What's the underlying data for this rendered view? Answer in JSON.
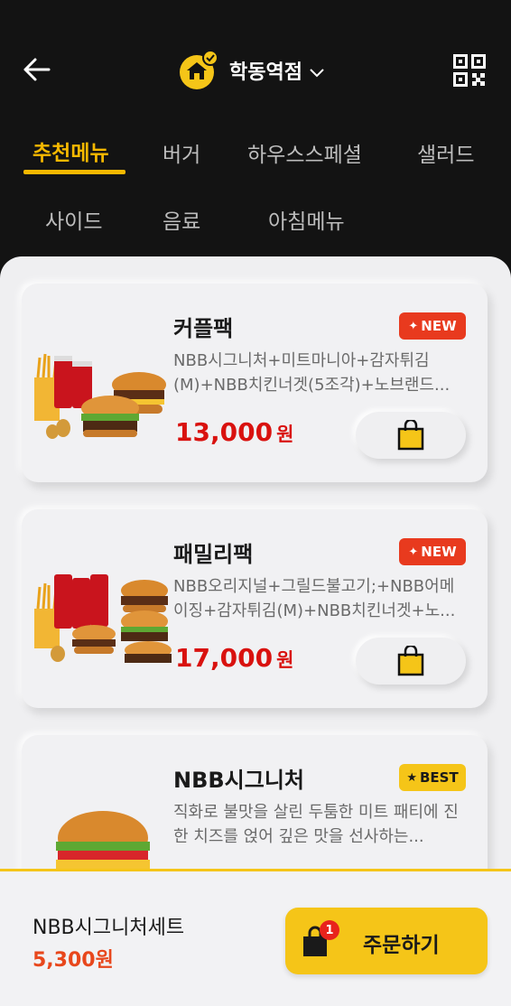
{
  "header": {
    "store_name": "학동역점",
    "tabs": [
      "추천메뉴",
      "버거",
      "하우스스페셜",
      "샐러드",
      "사이드",
      "음료",
      "아침메뉴"
    ],
    "active_tab": "추천메뉴"
  },
  "menu_items": [
    {
      "name": "커플팩",
      "badge": "NEW",
      "description": "NBB시그니처+미트마니아+감자튀김(M)+NBB치킨너겟(5조각)+노브랜드...",
      "price": "13,000",
      "currency": "원"
    },
    {
      "name": "패밀리팩",
      "badge": "NEW",
      "description": "NBB오리지널+그릴드불고기;+NBB어메이징+감자튀김(M)+NBB치킨너겟+노...",
      "price": "17,000",
      "currency": "원"
    },
    {
      "name": "NBB시그니처",
      "badge": "BEST",
      "description": "직화로 불맛을 살린 두툼한 미트 패티에 진한 치즈를 얹어 깊은 맛을 선사하는...",
      "price": "",
      "currency": ""
    }
  ],
  "cart": {
    "item_name": "NBB시그니처세트",
    "price": "5,300원",
    "count": "1",
    "order_label": "주문하기"
  },
  "colors": {
    "accent": "#f5b800",
    "price_red": "#d9120f",
    "new_badge": "#e83a1e",
    "best_badge": "#f5c518"
  }
}
